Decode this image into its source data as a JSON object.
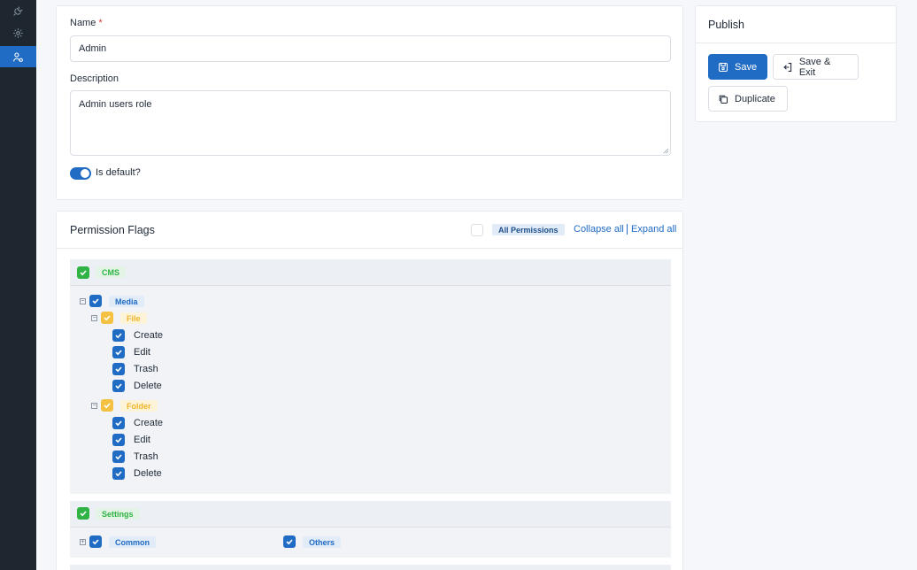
{
  "sidebar": {
    "items": [
      {
        "icon": "plug-icon"
      },
      {
        "icon": "gear-icon"
      },
      {
        "icon": "users-icon",
        "active": true
      }
    ]
  },
  "form": {
    "name_label": "Name",
    "name_required": "*",
    "name_value": "Admin",
    "description_label": "Description",
    "description_value": "Admin users role",
    "is_default_label": "Is default?"
  },
  "publish": {
    "title": "Publish",
    "save_label": "Save",
    "save_exit_label": "Save & Exit",
    "duplicate_label": "Duplicate"
  },
  "permissions": {
    "title": "Permission Flags",
    "all_permissions_label": "All Permissions",
    "collapse_all": "Collapse all",
    "expand_all": "Expand all",
    "cms": {
      "label": "CMS",
      "media_label": "Media",
      "file_label": "File",
      "file_items": [
        "Create",
        "Edit",
        "Trash",
        "Delete"
      ],
      "folder_label": "Folder",
      "folder_items": [
        "Create",
        "Edit",
        "Trash",
        "Delete"
      ]
    },
    "settings": {
      "label": "Settings",
      "common_label": "Common",
      "others_label": "Others"
    }
  },
  "colors": {
    "primary": "#206bc4",
    "green": "#2fb344",
    "yellow": "#f5c142",
    "sidebar": "#1e2730"
  }
}
